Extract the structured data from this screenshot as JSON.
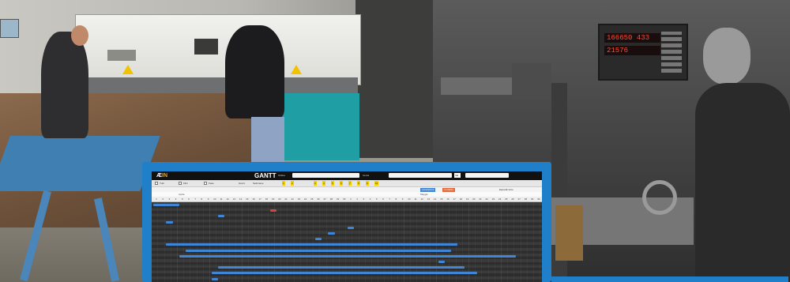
{
  "dro": {
    "line1": "166650",
    "line1_b": "433",
    "line2": "21576"
  },
  "app": {
    "logo_main": "Æ",
    "logo_suffix": "IN",
    "title": "GANTT",
    "top_labels": [
      "Ordine",
      "Cerca",
      "Vai"
    ],
    "search_placeholder": "",
    "top_button": "Vai"
  },
  "filterbar": {
    "labels": [
      "Tutti",
      "Filtri",
      "Fase",
      "Giorni",
      "Settimane"
    ],
    "chips": [
      "1",
      "2",
      "3",
      "4",
      "5",
      "6",
      "7",
      "8",
      "9",
      "10"
    ]
  },
  "subbar": {
    "left": "",
    "legend_blue": "Lavorazioni",
    "legend_red": "In ritardo",
    "right": "Espandi tutto"
  },
  "months": [
    "Aprile",
    "Maggio"
  ],
  "days": [
    "1",
    "2",
    "3",
    "4",
    "5",
    "6",
    "7",
    "8",
    "9",
    "10",
    "11",
    "12",
    "13",
    "14",
    "15",
    "16",
    "17",
    "18",
    "19",
    "20",
    "21",
    "22",
    "23",
    "24",
    "25",
    "26",
    "27",
    "28",
    "29",
    "30",
    "1",
    "2",
    "3",
    "4",
    "5",
    "6",
    "7",
    "8",
    "9",
    "10",
    "11",
    "12",
    "13",
    "14",
    "15",
    "16",
    "17",
    "18",
    "19",
    "20",
    "21",
    "22",
    "23",
    "24",
    "25",
    "26",
    "27",
    "28",
    "29",
    "30"
  ],
  "tasks": [
    {
      "label": "",
      "color": "#3f86d6",
      "start": 0,
      "length": 4
    },
    {
      "label": "",
      "color": "#d9443b",
      "start": 18,
      "length": 1
    },
    {
      "label": "",
      "color": "#3f86d6",
      "start": 10,
      "length": 1
    },
    {
      "label": "",
      "color": "#3f86d6",
      "start": 2,
      "length": 1
    },
    {
      "label": "",
      "color": "#3f86d6",
      "start": 30,
      "length": 1
    },
    {
      "label": "",
      "color": "#3f86d6",
      "start": 27,
      "length": 1
    },
    {
      "label": "",
      "color": "#3f86d6",
      "start": 25,
      "length": 1
    },
    {
      "label": "",
      "color": "#3f86d6",
      "start": 2,
      "length": 45
    },
    {
      "label": "",
      "color": "#3f86d6",
      "start": 5,
      "length": 41
    },
    {
      "label": "",
      "color": "#3f86d6",
      "start": 4,
      "length": 52
    },
    {
      "label": "",
      "color": "#3f86d6",
      "start": 44,
      "length": 1
    },
    {
      "label": "",
      "color": "#3f86d6",
      "start": 10,
      "length": 38
    },
    {
      "label": "",
      "color": "#3f86d6",
      "start": 9,
      "length": 41
    },
    {
      "label": "",
      "color": "#3f86d6",
      "start": 9,
      "length": 1
    },
    {
      "label": "",
      "color": "#3f86d6",
      "start": 11,
      "length": 1
    }
  ]
}
